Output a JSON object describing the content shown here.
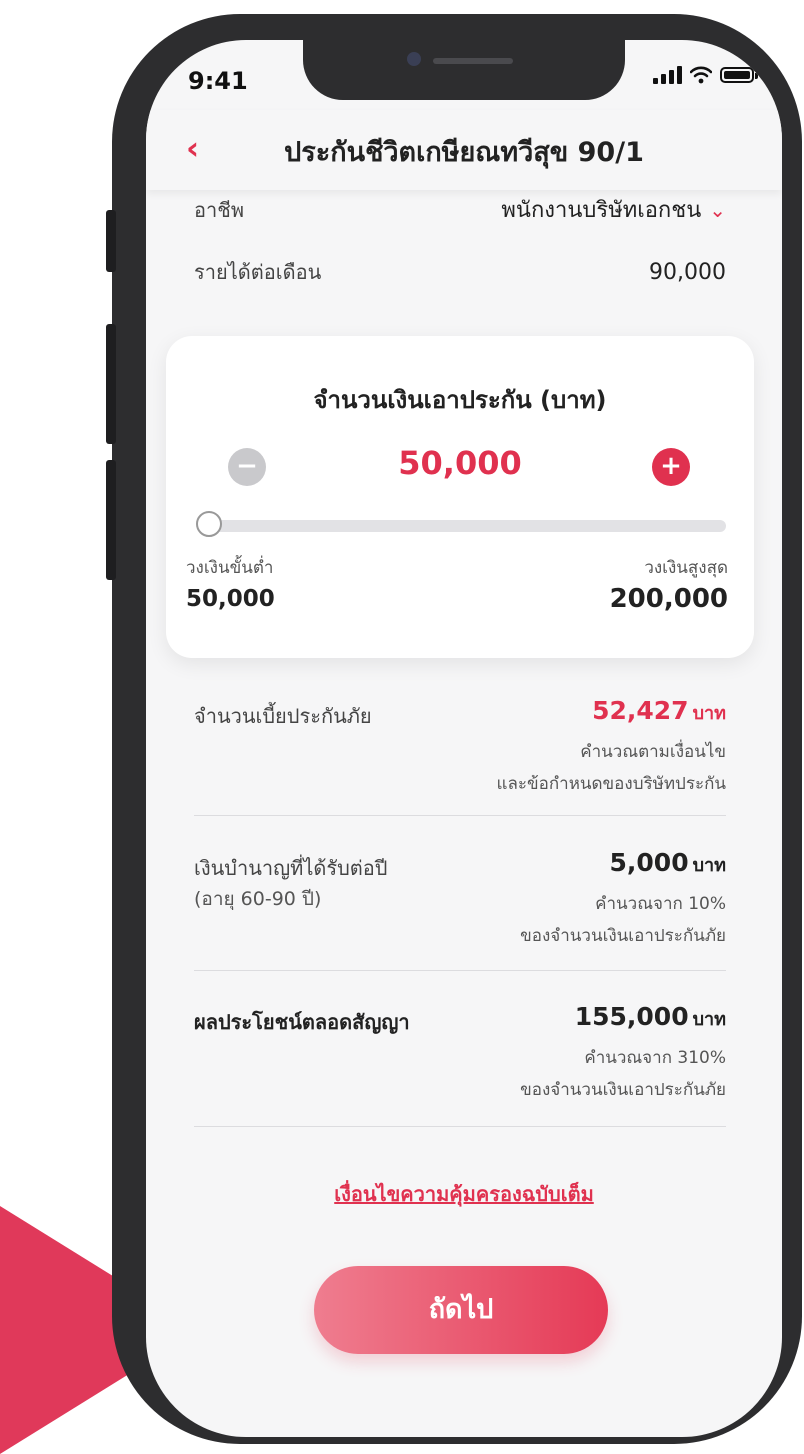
{
  "status_bar": {
    "time": "9:41"
  },
  "header": {
    "back_icon": "‹",
    "title": "ประกันชีวิตเกษียณทวีสุข 90/1"
  },
  "occupation": {
    "label": "อาชีพ",
    "value": "พนักงานบริษัทเอกชน",
    "chevron": "⌄"
  },
  "income": {
    "label": "รายได้ต่อเดือน",
    "value": "90,000"
  },
  "sum_card": {
    "title": "จำนวนเงินเอาประกัน (บาท)",
    "minus": "−",
    "plus": "+",
    "amount": "50,000",
    "slider_fraction": 0,
    "min_label": "วงเงินขั้นต่ำ",
    "min_value": "50,000",
    "max_label": "วงเงินสูงสุด",
    "max_value": "200,000"
  },
  "premium": {
    "label": "จำนวนเบี้ยประกันภัย",
    "value": "52,427",
    "unit": "บาท",
    "note1": "คำนวณตามเงื่อนไข",
    "note2": "และข้อกำหนดของบริษัทประกัน"
  },
  "annuity": {
    "label": "เงินบำนาญที่ได้รับต่อปี",
    "sublabel": "(อายุ 60-90 ปี)",
    "value": "5,000",
    "unit": "บาท",
    "note1": "คำนวณจาก 10%",
    "note2": "ของจำนวนเงินเอาประกันภัย"
  },
  "benefit": {
    "label": "ผลประโยชน์ตลอดสัญญา",
    "value": "155,000",
    "unit": "บาท",
    "note1": "คำนวณจาก 310%",
    "note2": "ของจำนวนเงินเอาประกันภัย"
  },
  "link": "เงื่อนไขความคุ้มครองฉบับเต็ม",
  "next_button": "ถัดไป",
  "colors": {
    "accent": "#e0314f",
    "phone_frame": "#2d2d2f",
    "background": "#f6f6f7"
  }
}
